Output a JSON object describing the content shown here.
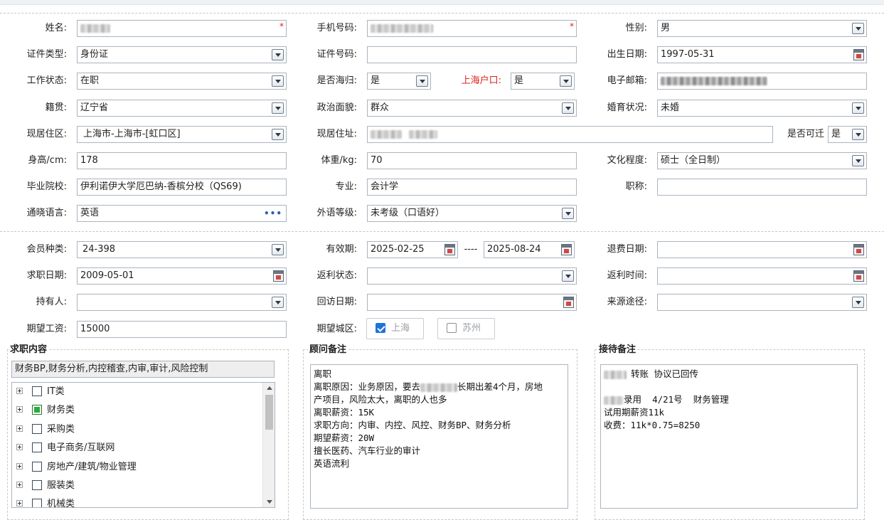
{
  "form": {
    "name": {
      "label": "姓名:",
      "required_mark": "*"
    },
    "phone": {
      "label": "手机号码:",
      "required_mark": "*"
    },
    "gender": {
      "label": "性别:",
      "value": "男"
    },
    "id_type": {
      "label": "证件类型:",
      "value": "身份证"
    },
    "id_number": {
      "label": "证件号码:",
      "value": ""
    },
    "birth_date": {
      "label": "出生日期:",
      "value": "1997-05-31"
    },
    "work_status": {
      "label": "工作状态:",
      "value": "在职"
    },
    "overseas_return": {
      "label": "是否海归:",
      "value": "是"
    },
    "shanghai_hukou": {
      "label": "上海户口:",
      "value": "是"
    },
    "email": {
      "label": "电子邮箱:"
    },
    "native_place": {
      "label": "籍贯:",
      "value": "辽宁省"
    },
    "political_status": {
      "label": "政治面貌:",
      "value": "群众"
    },
    "marital_status": {
      "label": "婚育状况:",
      "value": "未婚"
    },
    "current_area": {
      "label": "现居住区:",
      "value": "上海市-上海市-[虹口区]"
    },
    "current_address": {
      "label": "现居住址:"
    },
    "relocatable": {
      "label": "是否可迁",
      "value": "是"
    },
    "height": {
      "label": "身高/cm:",
      "value": "178"
    },
    "weight": {
      "label": "体重/kg:",
      "value": "70"
    },
    "education": {
      "label": "文化程度:",
      "value": "硕士（全日制）"
    },
    "school": {
      "label": "毕业院校:",
      "value": "伊利诺伊大学厄巴纳-香槟分校（QS69)"
    },
    "major": {
      "label": "专业:",
      "value": "会计学"
    },
    "title": {
      "label": "职称:",
      "value": ""
    },
    "language": {
      "label": "通晓语言:",
      "value": "英语",
      "more": "•••"
    },
    "foreign_level": {
      "label": "外语等级:",
      "value": "未考级（口语好）"
    }
  },
  "membership": {
    "member_type": {
      "label": "会员种类:",
      "value": "24-398"
    },
    "valid_period": {
      "label": "有效期:",
      "start": "2025-02-25",
      "sep": "----",
      "end": "2025-08-24"
    },
    "refund_date": {
      "label": "退费日期:",
      "value": ""
    },
    "job_date": {
      "label": "求职日期:",
      "value": "2009-05-01"
    },
    "rebate_status": {
      "label": "返利状态:",
      "value": ""
    },
    "rebate_time": {
      "label": "返利时间:",
      "value": ""
    },
    "holder": {
      "label": "持有人:",
      "value": ""
    },
    "revisit_date": {
      "label": "回访日期:",
      "value": ""
    },
    "source": {
      "label": "来源途径:",
      "value": ""
    },
    "expected_salary": {
      "label": "期望工资:",
      "value": "15000"
    },
    "expected_city": {
      "label": "期望城区:",
      "options": [
        {
          "label": "上海",
          "checked": true
        },
        {
          "label": "苏州",
          "checked": false
        }
      ]
    }
  },
  "job_content": {
    "title": "求职内容",
    "summary": "财务BP,财务分析,内控稽查,内审,审计,风险控制",
    "categories": [
      {
        "label": "IT类",
        "state": "none"
      },
      {
        "label": "财务类",
        "state": "partial"
      },
      {
        "label": "采购类",
        "state": "none"
      },
      {
        "label": "电子商务/互联网",
        "state": "none"
      },
      {
        "label": "房地产/建筑/物业管理",
        "state": "none"
      },
      {
        "label": "服装类",
        "state": "none"
      },
      {
        "label": "机械类",
        "state": "none"
      }
    ]
  },
  "consultant_notes": {
    "title": "顾问备注",
    "line1": "离职",
    "line2a": "离职原因：业务原因，要去",
    "line2b": "长期出差4个月，房地",
    "line3": "产项目，风险太大，离职的人也多",
    "line4": "离职薪资：15K",
    "line5": "求职方向：内审、内控、风控、财务BP、财务分析",
    "line6": "期望薪资：20W",
    "line7": "擅长医药、汽车行业的审计",
    "line8": "英语流利"
  },
  "reception_notes": {
    "title": "接待备注",
    "line1": "转账 协议已回传",
    "line2a": "录用",
    "line2b": "4/21号",
    "line2c": "财务管理",
    "line3": "试用期薪资11k",
    "line4": "收费：11k*0.75=8250"
  }
}
